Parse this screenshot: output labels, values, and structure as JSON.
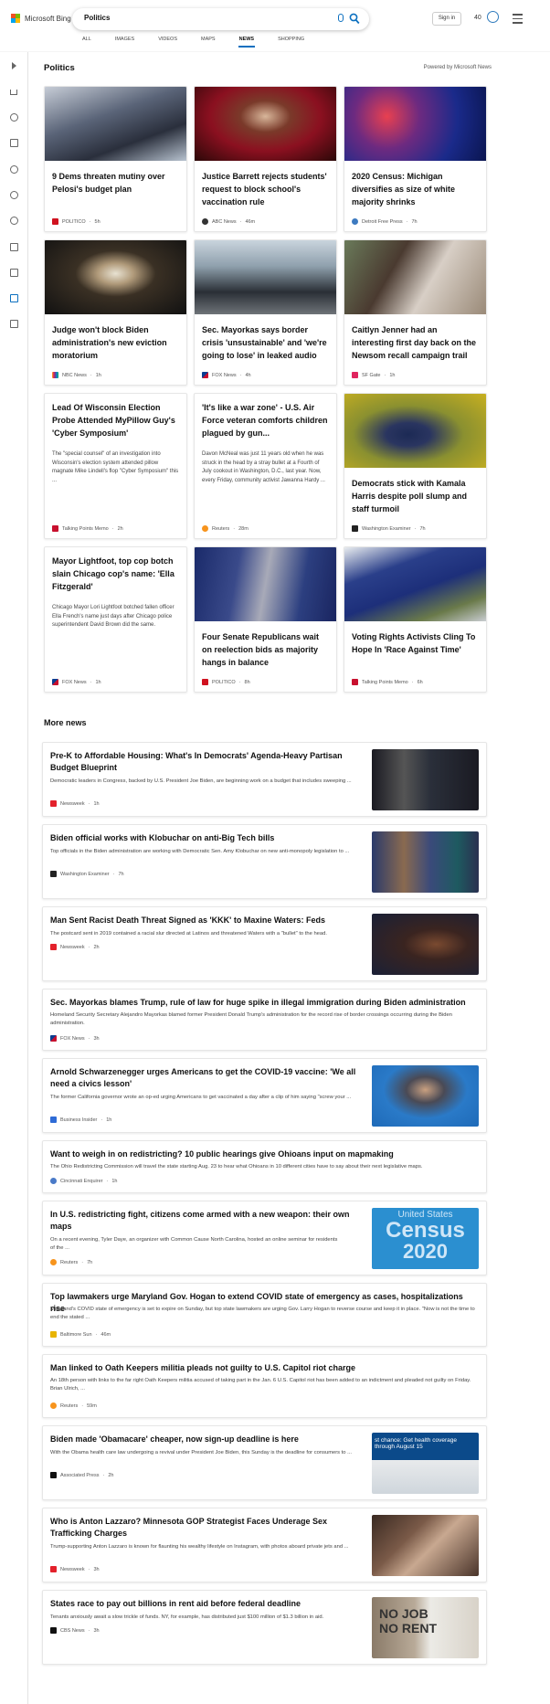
{
  "header": {
    "logo_text": "Microsoft Bing",
    "search_value": "Politics",
    "signin_label": "Sign in",
    "points": "40"
  },
  "tabs": [
    "ALL",
    "IMAGES",
    "VIDEOS",
    "MAPS",
    "NEWS",
    "SHOPPING"
  ],
  "active_tab": "NEWS",
  "section": {
    "title": "Politics",
    "powered_by": "Powered by Microsoft News"
  },
  "cards": [
    {
      "title": "9 Dems threaten mutiny over Pelosi's budget plan",
      "source": "POLITICO",
      "time": "5h",
      "desc": ""
    },
    {
      "title": "Justice Barrett rejects students' request to block school's vaccination rule",
      "source": "ABC News",
      "time": "46m",
      "desc": ""
    },
    {
      "title": "2020 Census: Michigan diversifies as size of white majority shrinks",
      "source": "Detroit Free Press",
      "time": "7h",
      "desc": ""
    },
    {
      "title": "Judge won't block Biden administration's new eviction moratorium",
      "source": "NBC News",
      "time": "1h",
      "desc": ""
    },
    {
      "title": "Sec. Mayorkas says border crisis 'unsustainable' and 'we're going to lose' in leaked audio",
      "source": "FOX News",
      "time": "4h",
      "desc": ""
    },
    {
      "title": "Caitlyn Jenner had an interesting first day back on the Newsom recall campaign trail",
      "source": "SF Gate",
      "time": "1h",
      "desc": ""
    },
    {
      "title": "Lead Of Wisconsin Election Probe Attended MyPillow Guy's 'Cyber Symposium'",
      "source": "Talking Points Memo",
      "time": "2h",
      "desc": "The \"special counsel\" of an investigation into Wisconsin's election system attended pillow magnate Mike Lindell's flop \"Cyber Symposium\" this ..."
    },
    {
      "title": "'It's like a war zone' - U.S. Air Force veteran comforts children plagued by gun...",
      "source": "Reuters",
      "time": "28m",
      "desc": "Davon McNeal was just 11 years old when he was struck in the head by a stray bullet at a Fourth of July cookout in Washington, D.C., last year. Now, every Friday, community activist Jawanna Hardy ..."
    },
    {
      "title": "Democrats stick with Kamala Harris despite poll slump and staff turmoil",
      "source": "Washington Examiner",
      "time": "7h",
      "desc": ""
    },
    {
      "title": "Mayor Lightfoot, top cop botch slain Chicago cop's name: 'Ella Fitzgerald'",
      "source": "FOX News",
      "time": "1h",
      "desc": "Chicago Mayor Lori Lightfoot botched fallen officer Ella French's name just days after Chicago police superintendent David Brown did the same."
    },
    {
      "title": "Four Senate Republicans wait on reelection bids as majority hangs in balance",
      "source": "POLITICO",
      "time": "8h",
      "desc": ""
    },
    {
      "title": "Voting Rights Activists Cling To Hope In 'Race Against Time'",
      "source": "Talking Points Memo",
      "time": "6h",
      "desc": ""
    }
  ],
  "more_news_title": "More news",
  "more_news": [
    {
      "title": "Pre-K to Affordable Housing: What's In Democrats' Agenda-Heavy Partisan Budget Blueprint",
      "desc": "Democratic leaders in Congress, backed by U.S. President Joe Biden, are beginning work on a budget that includes sweeping ...",
      "source": "Newsweek",
      "time": "1h"
    },
    {
      "title": "Biden official works with Klobuchar on anti-Big Tech bills",
      "desc": "Top officials in the Biden administration are working with Democratic Sen. Amy Klobuchar on new anti-monopoly legislation to ...",
      "source": "Washington Examiner",
      "time": "7h"
    },
    {
      "title": "Man Sent Racist Death Threat Signed as 'KKK' to Maxine Waters: Feds",
      "desc": "The postcard sent in 2019 contained a racial slur directed at Latinos and threatened Waters with a \"bullet\" to the head.",
      "source": "Newsweek",
      "time": "2h"
    },
    {
      "title": "Sec. Mayorkas blames Trump, rule of law for huge spike in illegal immigration during Biden administration",
      "desc": "Homeland Security Secretary Alejandro Mayorkas blamed former President Donald Trump's administration for the record rise of border crossings occurring during the Biden administration.",
      "source": "FOX News",
      "time": "3h"
    },
    {
      "title": "Arnold Schwarzenegger urges Americans to get the COVID-19 vaccine: 'We all need a civics lesson'",
      "desc": "The former California governor wrote an op-ed urging Americans to get vaccinated a day after a clip of him saying \"screw your ...",
      "source": "Business Insider",
      "time": "1h"
    },
    {
      "title": "Want to weigh in on redistricting? 10 public hearings give Ohioans input on mapmaking",
      "desc": "The Ohio Redistricting Commission will travel the state starting Aug. 23 to hear what Ohioans in 10 different cities have to say about their next legislative maps.",
      "source": "Cincinnati Enquirer",
      "time": "1h"
    },
    {
      "title": "In U.S. redistricting fight, citizens come armed with a new weapon: their own maps",
      "desc": "On a recent evening, Tyler Daye, an organizer with Common Cause North Carolina, hosted an online seminar for residents of the ...",
      "source": "Reuters",
      "time": "7h",
      "img_text_1": "United States",
      "img_text_2": "Census",
      "img_text_3": "2020"
    },
    {
      "title": "Top lawmakers urge Maryland Gov. Hogan to extend COVID state of emergency as cases, hospitalizations rise",
      "desc": "Maryland's COVID state of emergency is set to expire on Sunday, but top state lawmakers are urging Gov. Larry Hogan to reverse course and keep it in place. \"Now is not the time to end the stated ...",
      "source": "Baltimore Sun",
      "time": "46m"
    },
    {
      "title": "Man linked to Oath Keepers militia pleads not guilty to U.S. Capitol riot charge",
      "desc": "An 18th person with links to the far right Oath Keepers militia accused of taking part in the Jan. 6 U.S. Capitol riot has been added to an indictment and pleaded not guilty on Friday. Brian Ulrich, ...",
      "source": "Reuters",
      "time": "59m"
    },
    {
      "title": "Biden made 'Obamacare' cheaper, now sign-up deadline is here",
      "desc": "With the Obama health care law undergoing a revival under President Joe Biden, this Sunday is the deadline for consumers to ...",
      "source": "Associated Press",
      "time": "2h",
      "img_text_1": "st chance: Get health coverage",
      "img_text_2": "through August 15"
    },
    {
      "title": "Who is Anton Lazzaro? Minnesota GOP Strategist Faces Underage Sex Trafficking Charges",
      "desc": "Trump-supporting Anton Lazzaro is known for flaunting his wealthy lifestyle on Instagram, with photos aboard private jets and ...",
      "source": "Newsweek",
      "time": "3h"
    },
    {
      "title": "States race to pay out billions in rent aid before federal deadline",
      "desc": "Tenants anxiously await a slow trickle of funds. NY, for example, has distributed just $100 million of $1.3 billion in aid.",
      "source": "CBS News",
      "time": "3h",
      "img_text_1": "NO JOB",
      "img_text_2": "NO RENT"
    }
  ],
  "colors": {
    "accent": "#0b6fbf",
    "politico": "#d0121f",
    "newsweek": "#e3212b"
  }
}
